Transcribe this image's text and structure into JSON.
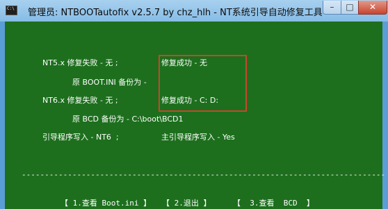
{
  "window": {
    "title": "管理员: NTBOOTautofix v2.5.7 by chz_hlh - NT系统引导自动修复工具",
    "icon": "C:\\",
    "controls": {
      "minimize": "–",
      "maximize": "□",
      "close": "✕"
    }
  },
  "console": {
    "nt5_fail": "NT5.x 修复失败 - 无 ;",
    "nt5_success": "修复成功 - 无",
    "nt5_backup": "原 BOOT.INI 备份为 -",
    "nt6_fail": "NT6.x 修复失败 - 无 ;",
    "nt6_success": "修复成功 - C: D:",
    "nt6_backup": "原 BCD 备份为 - C:\\boot\\BCD1",
    "boot_write": "引导程序写入 - NT6  ;",
    "mbr_write": "主引导程序写入 - Yes",
    "separator": "-------------------------------------------------------------------------------"
  },
  "menu": [
    {
      "label": "【 1.查看 Boot.ini 】"
    },
    {
      "label": "【 2.退出 】"
    },
    {
      "label": "【  3.查看  BCD  】"
    }
  ]
}
